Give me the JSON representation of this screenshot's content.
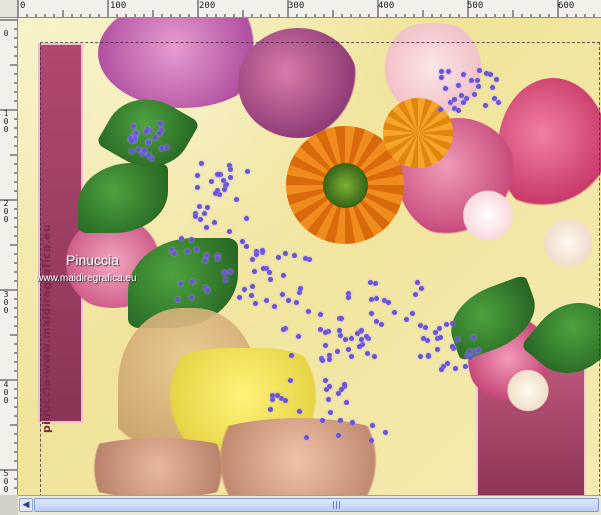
{
  "ruler": {
    "h_labels": [
      "0",
      "100",
      "200",
      "300",
      "400",
      "500",
      "600"
    ],
    "v_labels": [
      {
        "lines": [
          "0"
        ]
      },
      {
        "lines": [
          "1",
          "0",
          "0"
        ]
      },
      {
        "lines": [
          "2",
          "0",
          "0"
        ]
      },
      {
        "lines": [
          "3",
          "0",
          "0"
        ]
      },
      {
        "lines": [
          "4",
          "0",
          "0"
        ]
      },
      {
        "lines": [
          "5",
          "0",
          "0"
        ]
      }
    ]
  },
  "watermark": {
    "title": "Pinuccia",
    "url": "www.maidiregrafica.eu",
    "vertical": "pinuccia-www.maidiregrafica.eu"
  },
  "colors": {
    "frame_pink": "#b04870",
    "flower_orange": "#f08c1e",
    "lavender": "#6a53d6",
    "dress_yellow": "#f2e24a"
  },
  "scrollbar": {
    "left_arrow": "◀",
    "right_arrow": "▶"
  }
}
